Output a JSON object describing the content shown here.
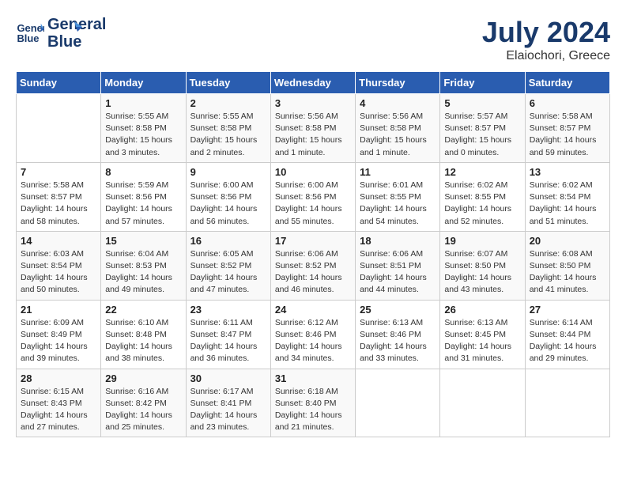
{
  "header": {
    "logo_line1": "General",
    "logo_line2": "Blue",
    "month_title": "July 2024",
    "location": "Elaiochori, Greece"
  },
  "days_of_week": [
    "Sunday",
    "Monday",
    "Tuesday",
    "Wednesday",
    "Thursday",
    "Friday",
    "Saturday"
  ],
  "weeks": [
    [
      {
        "day": "",
        "info": ""
      },
      {
        "day": "1",
        "info": "Sunrise: 5:55 AM\nSunset: 8:58 PM\nDaylight: 15 hours\nand 3 minutes."
      },
      {
        "day": "2",
        "info": "Sunrise: 5:55 AM\nSunset: 8:58 PM\nDaylight: 15 hours\nand 2 minutes."
      },
      {
        "day": "3",
        "info": "Sunrise: 5:56 AM\nSunset: 8:58 PM\nDaylight: 15 hours\nand 1 minute."
      },
      {
        "day": "4",
        "info": "Sunrise: 5:56 AM\nSunset: 8:58 PM\nDaylight: 15 hours\nand 1 minute."
      },
      {
        "day": "5",
        "info": "Sunrise: 5:57 AM\nSunset: 8:57 PM\nDaylight: 15 hours\nand 0 minutes."
      },
      {
        "day": "6",
        "info": "Sunrise: 5:58 AM\nSunset: 8:57 PM\nDaylight: 14 hours\nand 59 minutes."
      }
    ],
    [
      {
        "day": "7",
        "info": "Sunrise: 5:58 AM\nSunset: 8:57 PM\nDaylight: 14 hours\nand 58 minutes."
      },
      {
        "day": "8",
        "info": "Sunrise: 5:59 AM\nSunset: 8:56 PM\nDaylight: 14 hours\nand 57 minutes."
      },
      {
        "day": "9",
        "info": "Sunrise: 6:00 AM\nSunset: 8:56 PM\nDaylight: 14 hours\nand 56 minutes."
      },
      {
        "day": "10",
        "info": "Sunrise: 6:00 AM\nSunset: 8:56 PM\nDaylight: 14 hours\nand 55 minutes."
      },
      {
        "day": "11",
        "info": "Sunrise: 6:01 AM\nSunset: 8:55 PM\nDaylight: 14 hours\nand 54 minutes."
      },
      {
        "day": "12",
        "info": "Sunrise: 6:02 AM\nSunset: 8:55 PM\nDaylight: 14 hours\nand 52 minutes."
      },
      {
        "day": "13",
        "info": "Sunrise: 6:02 AM\nSunset: 8:54 PM\nDaylight: 14 hours\nand 51 minutes."
      }
    ],
    [
      {
        "day": "14",
        "info": "Sunrise: 6:03 AM\nSunset: 8:54 PM\nDaylight: 14 hours\nand 50 minutes."
      },
      {
        "day": "15",
        "info": "Sunrise: 6:04 AM\nSunset: 8:53 PM\nDaylight: 14 hours\nand 49 minutes."
      },
      {
        "day": "16",
        "info": "Sunrise: 6:05 AM\nSunset: 8:52 PM\nDaylight: 14 hours\nand 47 minutes."
      },
      {
        "day": "17",
        "info": "Sunrise: 6:06 AM\nSunset: 8:52 PM\nDaylight: 14 hours\nand 46 minutes."
      },
      {
        "day": "18",
        "info": "Sunrise: 6:06 AM\nSunset: 8:51 PM\nDaylight: 14 hours\nand 44 minutes."
      },
      {
        "day": "19",
        "info": "Sunrise: 6:07 AM\nSunset: 8:50 PM\nDaylight: 14 hours\nand 43 minutes."
      },
      {
        "day": "20",
        "info": "Sunrise: 6:08 AM\nSunset: 8:50 PM\nDaylight: 14 hours\nand 41 minutes."
      }
    ],
    [
      {
        "day": "21",
        "info": "Sunrise: 6:09 AM\nSunset: 8:49 PM\nDaylight: 14 hours\nand 39 minutes."
      },
      {
        "day": "22",
        "info": "Sunrise: 6:10 AM\nSunset: 8:48 PM\nDaylight: 14 hours\nand 38 minutes."
      },
      {
        "day": "23",
        "info": "Sunrise: 6:11 AM\nSunset: 8:47 PM\nDaylight: 14 hours\nand 36 minutes."
      },
      {
        "day": "24",
        "info": "Sunrise: 6:12 AM\nSunset: 8:46 PM\nDaylight: 14 hours\nand 34 minutes."
      },
      {
        "day": "25",
        "info": "Sunrise: 6:13 AM\nSunset: 8:46 PM\nDaylight: 14 hours\nand 33 minutes."
      },
      {
        "day": "26",
        "info": "Sunrise: 6:13 AM\nSunset: 8:45 PM\nDaylight: 14 hours\nand 31 minutes."
      },
      {
        "day": "27",
        "info": "Sunrise: 6:14 AM\nSunset: 8:44 PM\nDaylight: 14 hours\nand 29 minutes."
      }
    ],
    [
      {
        "day": "28",
        "info": "Sunrise: 6:15 AM\nSunset: 8:43 PM\nDaylight: 14 hours\nand 27 minutes."
      },
      {
        "day": "29",
        "info": "Sunrise: 6:16 AM\nSunset: 8:42 PM\nDaylight: 14 hours\nand 25 minutes."
      },
      {
        "day": "30",
        "info": "Sunrise: 6:17 AM\nSunset: 8:41 PM\nDaylight: 14 hours\nand 23 minutes."
      },
      {
        "day": "31",
        "info": "Sunrise: 6:18 AM\nSunset: 8:40 PM\nDaylight: 14 hours\nand 21 minutes."
      },
      {
        "day": "",
        "info": ""
      },
      {
        "day": "",
        "info": ""
      },
      {
        "day": "",
        "info": ""
      }
    ]
  ]
}
